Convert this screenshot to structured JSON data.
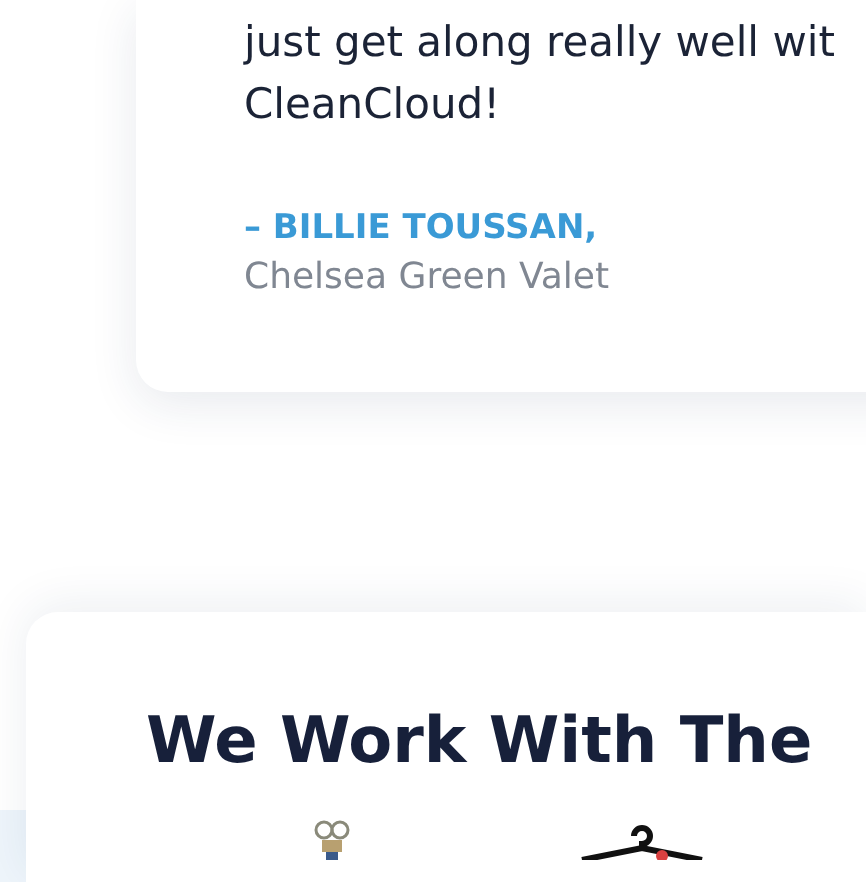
{
  "testimonial": {
    "lines": [
      "just get along really well wit",
      "CleanCloud!"
    ],
    "author": "– BILLIE TOUSSAN,",
    "company": "Chelsea Green Valet"
  },
  "partners": {
    "heading": "We Work With The"
  }
}
